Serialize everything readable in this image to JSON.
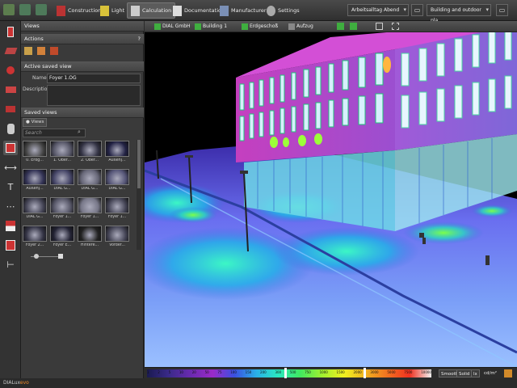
{
  "topbar": {
    "modes": [
      {
        "label": "Construction",
        "icon": "construction-icon"
      },
      {
        "label": "Light",
        "icon": "lamp-icon"
      },
      {
        "label": "Calculation",
        "icon": "calculation-icon"
      },
      {
        "label": "Documentation",
        "icon": "documentation-icon"
      },
      {
        "label": "Manufacturer",
        "icon": "manufacturer-icon"
      },
      {
        "label": "Settings",
        "icon": "gear-icon"
      }
    ],
    "scene_select": "Arbeitsalltag Abend",
    "view_select": "Building and outdoor pla..."
  },
  "panel": {
    "views_header": "Views",
    "actions_header": "Actions",
    "help_glyph": "?",
    "active_header": "Active saved view",
    "name_label": "Name",
    "name_value": "Foyer 1.OG",
    "description_label": "Description",
    "saved_header": "Saved views",
    "views_tab": "Views",
    "search_placeholder": "Search",
    "thumbnails": [
      "0. Erdg...",
      "1. Ober...",
      "2. Ober...",
      "Außenj...",
      "Außenj...",
      "DIAL G...",
      "DIAL G...",
      "DIAL G...",
      "DIAL G...",
      "Foyer 1...",
      "Foyer 1...",
      "Foyer 1...",
      "Foyer 2...",
      "Foyer E...",
      "Hintere...",
      "Vorder..."
    ]
  },
  "viewport": {
    "breadcrumbs": [
      "DIAL GmbH",
      "Building 1",
      "Erdgeschoß",
      "Aufzug"
    ]
  },
  "legend": {
    "scale_labels": [
      "1",
      "2",
      "5",
      "10",
      "20",
      "50",
      "75",
      "100",
      "150",
      "200",
      "300",
      "500",
      "750",
      "1000",
      "1500",
      "2000",
      "3000",
      "5000",
      "7500",
      "10000"
    ],
    "smooth": "Smooth",
    "solid": "Solid",
    "unit_lx": "lx",
    "unit_cd": "cd/m²"
  },
  "status": {
    "brand": "DIALux",
    "brand_suffix": "evo"
  }
}
